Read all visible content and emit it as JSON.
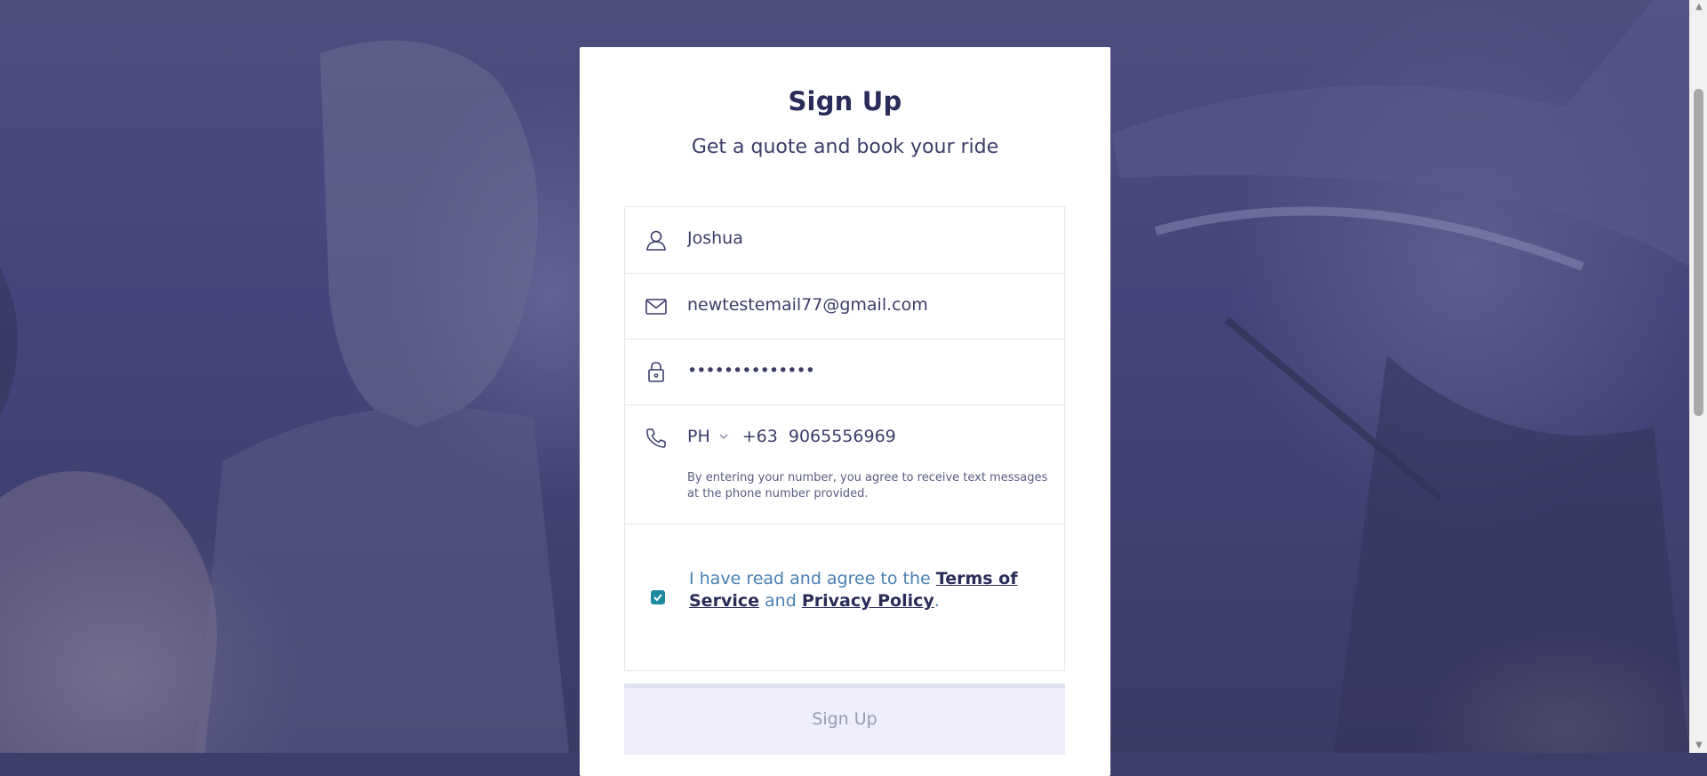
{
  "card": {
    "title": "Sign Up",
    "subtitle": "Get a quote and book your ride"
  },
  "form": {
    "first_name": {
      "value": "Joshua",
      "icon": "user-icon"
    },
    "email": {
      "value": "newtestemail77@gmail.com",
      "icon": "envelope-icon"
    },
    "password": {
      "value": "••••••••••••••",
      "icon": "lock-icon"
    },
    "phone": {
      "icon": "phone-icon",
      "country": "PH",
      "dial_code": "+63",
      "number": "9065556969",
      "note": "By entering your number, you agree to receive text messages at the phone number provided."
    },
    "terms": {
      "checked": true,
      "prefix": "I have read and agree to the ",
      "tos_label": "Terms of Service",
      "middle": " and ",
      "privacy_label": "Privacy Policy",
      "suffix": "."
    }
  },
  "submit": {
    "label": "Sign Up"
  },
  "colors": {
    "accent": "#1f8a9e",
    "title": "#2a2c5a",
    "button_bg": "#eeeefc",
    "overlay": "#44457a"
  }
}
